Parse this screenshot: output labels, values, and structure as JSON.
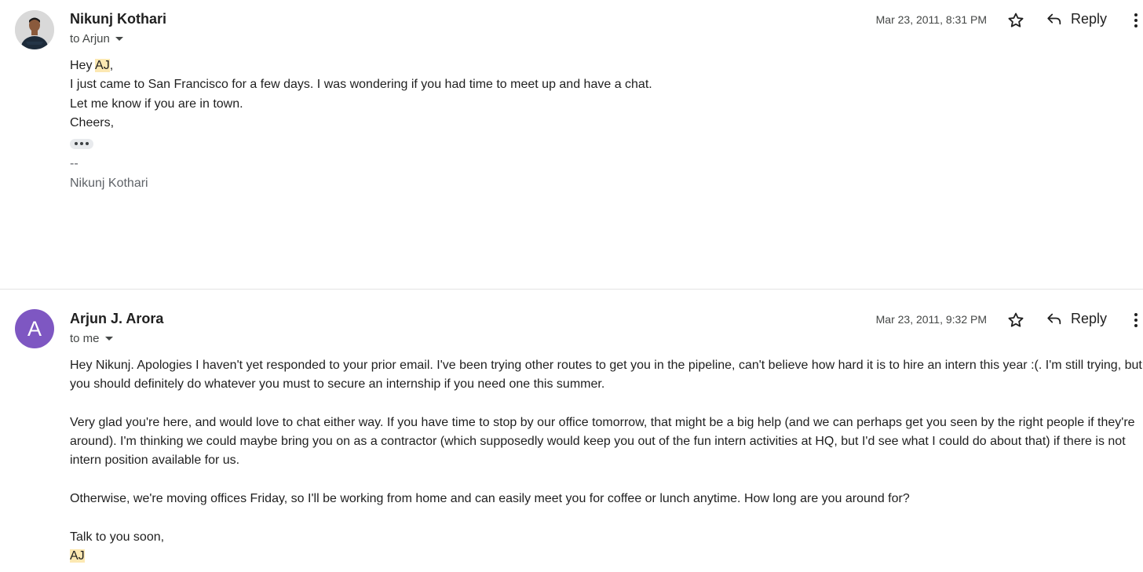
{
  "messages": [
    {
      "sender": "Nikunj Kothari",
      "recipient": "to Arjun",
      "date": "Mar 23, 2011, 8:31 PM",
      "reply_label": "Reply",
      "avatar_type": "photo",
      "body": {
        "greeting_prefix": "Hey ",
        "greeting_highlight": "AJ",
        "greeting_suffix": ",",
        "line1": "I just came to San Francisco for a few days. I was wondering if you had time to meet up and have a chat.",
        "line2": "Let me know if you are in town.",
        "line3": "Cheers,"
      },
      "signature_dash": "--",
      "signature_name": "Nikunj Kothari"
    },
    {
      "sender": "Arjun J. Arora",
      "recipient": "to me",
      "date": "Mar 23, 2011, 9:32 PM",
      "reply_label": "Reply",
      "avatar_letter": "A",
      "avatar_color": "#7e57c2",
      "body": {
        "para1": "Hey Nikunj. Apologies I haven't yet responded to your prior email. I've been trying other routes to get you in the pipeline, can't believe how hard it is to hire an intern this year :(. I'm still trying, but you should definitely do whatever you must to secure an internship if you need one this summer.",
        "para2": "Very glad you're here, and would love to chat either way. If you have time to stop by our office tomorrow, that might be a big help (and we can perhaps get you seen by the right people if they're around). I'm thinking we could maybe bring you on as a contractor (which supposedly would keep you out of the fun intern activities at HQ, but I'd see what I could do about that) if there is not intern position available for us.",
        "para3": "Otherwise, we're moving offices Friday, so I'll be working from home and can easily meet you for coffee or lunch anytime. How long are you around for?",
        "closing": "Talk to you soon,",
        "signoff_highlight": "AJ"
      }
    }
  ],
  "icons": {
    "star": "star-outline-icon",
    "reply": "reply-arrow-icon",
    "more": "more-vert-icon",
    "caret": "caret-down-icon",
    "ellipsis": "show-trimmed-content-icon"
  },
  "colors": {
    "highlight": "#fce8b2",
    "divider": "#e3e3e3",
    "text": "#1f1f1f",
    "muted": "#444746"
  }
}
